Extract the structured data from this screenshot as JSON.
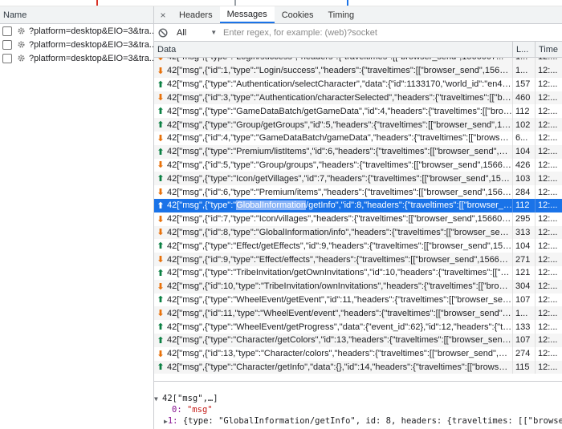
{
  "left_panel": {
    "header": "Name",
    "requests": [
      {
        "name": "?platform=desktop&EIO=3&tra..."
      },
      {
        "name": "?platform=desktop&EIO=3&tra..."
      },
      {
        "name": "?platform=desktop&EIO=3&tra..."
      }
    ]
  },
  "tabs": {
    "close": "×",
    "items": [
      "Headers",
      "Messages",
      "Cookies",
      "Timing"
    ],
    "active": "Messages"
  },
  "filter": {
    "select_value": "All",
    "placeholder": "Enter regex, for example: (web)?socket"
  },
  "columns": {
    "data": "Data",
    "length": "L...",
    "time": "Time"
  },
  "messages": [
    {
      "dir": "down",
      "text": "42[\"msg\",{\"type\":\"Login/success\",\"headers\":{\"traveltimes\":[[\"browser_send\",1566007...",
      "len": "1...",
      "time": "12:..."
    },
    {
      "dir": "down",
      "text": "42[\"msg\",{\"id\":1,\"type\":\"Login/success\",\"headers\":{\"traveltimes\":[[\"browser_send\",1566007...",
      "len": "1...",
      "time": "12:..."
    },
    {
      "dir": "up",
      "text": "42[\"msg\",{\"type\":\"Authentication/selectCharacter\",\"data\":{\"id\":1133170,\"world_id\":\"en45\"},\"...",
      "len": "157",
      "time": "12:..."
    },
    {
      "dir": "down",
      "text": "42[\"msg\",{\"id\":3,\"type\":\"Authentication/characterSelected\",\"headers\":{\"traveltimes\":[[\"brows...",
      "len": "460",
      "time": "12:..."
    },
    {
      "dir": "up",
      "text": "42[\"msg\",{\"type\":\"GameDataBatch/getGameData\",\"id\":4,\"headers\":{\"traveltimes\":[[\"browser...",
      "len": "112",
      "time": "12:..."
    },
    {
      "dir": "up",
      "text": "42[\"msg\",{\"type\":\"Group/getGroups\",\"id\":5,\"headers\":{\"traveltimes\":[[\"browser_send\",15660...",
      "len": "102",
      "time": "12:..."
    },
    {
      "dir": "down",
      "text": "42[\"msg\",{\"id\":4,\"type\":\"GameDataBatch/gameData\",\"headers\":{\"traveltimes\":[[\"browser_se...",
      "len": "6...",
      "time": "12:..."
    },
    {
      "dir": "up",
      "text": "42[\"msg\",{\"type\":\"Premium/listItems\",\"id\":6,\"headers\":{\"traveltimes\":[[\"browser_send\",1566...",
      "len": "104",
      "time": "12:..."
    },
    {
      "dir": "down",
      "text": "42[\"msg\",{\"id\":5,\"type\":\"Group/groups\",\"headers\":{\"traveltimes\":[[\"browser_send\",15660077...",
      "len": "426",
      "time": "12:..."
    },
    {
      "dir": "up",
      "text": "42[\"msg\",{\"type\":\"Icon/getVillages\",\"id\":7,\"headers\":{\"traveltimes\":[[\"browser_send\",156600...",
      "len": "103",
      "time": "12:..."
    },
    {
      "dir": "down",
      "text": "42[\"msg\",{\"id\":6,\"type\":\"Premium/items\",\"headers\":{\"traveltimes\":[[\"browser_send\",1566007...",
      "len": "284",
      "time": "12:..."
    },
    {
      "dir": "up",
      "text_pre": "42[\"msg\",{\"type\":\"",
      "text_hl": "GlobalInformation",
      "text_post": "/getInfo\",\"id\":8,\"headers\":{\"traveltimes\":[[\"browser_send\"...",
      "len": "112",
      "time": "12:...",
      "selected": true
    },
    {
      "dir": "down",
      "text": "42[\"msg\",{\"id\":7,\"type\":\"Icon/villages\",\"headers\":{\"traveltimes\":[[\"browser_send\",156600775...",
      "len": "295",
      "time": "12:..."
    },
    {
      "dir": "down",
      "text": "42[\"msg\",{\"id\":8,\"type\":\"GlobalInformation/info\",\"headers\":{\"traveltimes\":[[\"browser_send\",1...",
      "len": "313",
      "time": "12:..."
    },
    {
      "dir": "up",
      "text": "42[\"msg\",{\"type\":\"Effect/getEffects\",\"id\":9,\"headers\":{\"traveltimes\":[[\"browser_send\",156600...",
      "len": "104",
      "time": "12:..."
    },
    {
      "dir": "down",
      "text": "42[\"msg\",{\"id\":9,\"type\":\"Effect/effects\",\"headers\":{\"traveltimes\":[[\"browser_send\",15660077...",
      "len": "271",
      "time": "12:..."
    },
    {
      "dir": "up",
      "text": "42[\"msg\",{\"type\":\"TribeInvitation/getOwnInvitations\",\"id\":10,\"headers\":{\"traveltimes\":[[\"bro...",
      "len": "121",
      "time": "12:..."
    },
    {
      "dir": "down",
      "text": "42[\"msg\",{\"id\":10,\"type\":\"TribeInvitation/ownInvitations\",\"headers\":{\"traveltimes\":[[\"browser_...",
      "len": "304",
      "time": "12:..."
    },
    {
      "dir": "up",
      "text": "42[\"msg\",{\"type\":\"WheelEvent/getEvent\",\"id\":11,\"headers\":{\"traveltimes\":[[\"browser_send\",1...",
      "len": "107",
      "time": "12:..."
    },
    {
      "dir": "down",
      "text": "42[\"msg\",{\"id\":11,\"type\":\"WheelEvent/event\",\"headers\":{\"traveltimes\":[[\"browser_send\",156...",
      "len": "1...",
      "time": "12:..."
    },
    {
      "dir": "up",
      "text": "42[\"msg\",{\"type\":\"WheelEvent/getProgress\",\"data\":{\"event_id\":62},\"id\":12,\"headers\":{\"travel...",
      "len": "133",
      "time": "12:..."
    },
    {
      "dir": "up",
      "text": "42[\"msg\",{\"type\":\"Character/getColors\",\"id\":13,\"headers\":{\"traveltimes\":[[\"browser_send\",1...",
      "len": "107",
      "time": "12:..."
    },
    {
      "dir": "down",
      "text": "42[\"msg\",{\"id\":13,\"type\":\"Character/colors\",\"headers\":{\"traveltimes\":[[\"browser_send\",1566...",
      "len": "274",
      "time": "12:..."
    },
    {
      "dir": "up",
      "text": "42[\"msg\",{\"type\":\"Character/getInfo\",\"data\":{},\"id\":14,\"headers\":{\"traveltimes\":[[\"browser_se...",
      "len": "115",
      "time": "12:..."
    }
  ],
  "detail": {
    "root": "42[\"msg\",…]",
    "item0_key": "0:",
    "item0_val": "\"msg\"",
    "item1_key": "1:",
    "item1_val": "{type: \"GlobalInformation/getInfo\", id: 8, headers: {traveltimes: [[\"browser_send\","
  },
  "colors": {
    "accent": "#1a73e8",
    "sent": "#0b8043",
    "received": "#e8710a"
  }
}
